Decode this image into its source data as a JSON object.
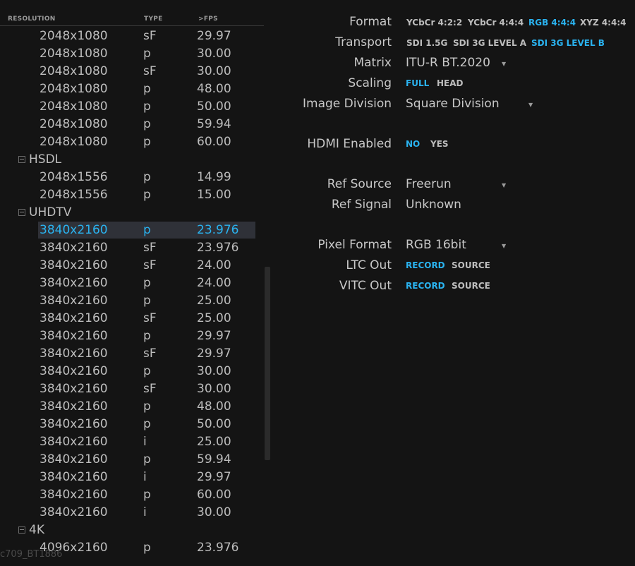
{
  "columns": {
    "resolution": "RESOLUTION",
    "type": "TYPE",
    "fps": ">FPS"
  },
  "list": [
    {
      "kind": "row",
      "res": "2048x1080",
      "type": "sF",
      "fps": "29.97"
    },
    {
      "kind": "row",
      "res": "2048x1080",
      "type": "p",
      "fps": "30.00"
    },
    {
      "kind": "row",
      "res": "2048x1080",
      "type": "sF",
      "fps": "30.00"
    },
    {
      "kind": "row",
      "res": "2048x1080",
      "type": "p",
      "fps": "48.00"
    },
    {
      "kind": "row",
      "res": "2048x1080",
      "type": "p",
      "fps": "50.00"
    },
    {
      "kind": "row",
      "res": "2048x1080",
      "type": "p",
      "fps": "59.94"
    },
    {
      "kind": "row",
      "res": "2048x1080",
      "type": "p",
      "fps": "60.00"
    },
    {
      "kind": "group",
      "label": "HSDL"
    },
    {
      "kind": "row",
      "res": "2048x1556",
      "type": "p",
      "fps": "14.99"
    },
    {
      "kind": "row",
      "res": "2048x1556",
      "type": "p",
      "fps": "15.00"
    },
    {
      "kind": "group",
      "label": "UHDTV"
    },
    {
      "kind": "row",
      "res": "3840x2160",
      "type": "p",
      "fps": "23.976",
      "selected": true
    },
    {
      "kind": "row",
      "res": "3840x2160",
      "type": "sF",
      "fps": "23.976"
    },
    {
      "kind": "row",
      "res": "3840x2160",
      "type": "sF",
      "fps": "24.00"
    },
    {
      "kind": "row",
      "res": "3840x2160",
      "type": "p",
      "fps": "24.00"
    },
    {
      "kind": "row",
      "res": "3840x2160",
      "type": "p",
      "fps": "25.00"
    },
    {
      "kind": "row",
      "res": "3840x2160",
      "type": "sF",
      "fps": "25.00"
    },
    {
      "kind": "row",
      "res": "3840x2160",
      "type": "p",
      "fps": "29.97"
    },
    {
      "kind": "row",
      "res": "3840x2160",
      "type": "sF",
      "fps": "29.97"
    },
    {
      "kind": "row",
      "res": "3840x2160",
      "type": "p",
      "fps": "30.00"
    },
    {
      "kind": "row",
      "res": "3840x2160",
      "type": "sF",
      "fps": "30.00"
    },
    {
      "kind": "row",
      "res": "3840x2160",
      "type": "p",
      "fps": "48.00"
    },
    {
      "kind": "row",
      "res": "3840x2160",
      "type": "p",
      "fps": "50.00"
    },
    {
      "kind": "row",
      "res": "3840x2160",
      "type": "i",
      "fps": "25.00"
    },
    {
      "kind": "row",
      "res": "3840x2160",
      "type": "p",
      "fps": "59.94"
    },
    {
      "kind": "row",
      "res": "3840x2160",
      "type": "i",
      "fps": "29.97"
    },
    {
      "kind": "row",
      "res": "3840x2160",
      "type": "p",
      "fps": "60.00"
    },
    {
      "kind": "row",
      "res": "3840x2160",
      "type": "i",
      "fps": "30.00"
    },
    {
      "kind": "group",
      "label": "4K"
    },
    {
      "kind": "row",
      "res": "4096x2160",
      "type": "p",
      "fps": "23.976"
    }
  ],
  "footer_label": "c709_BT1886",
  "settings": {
    "format": {
      "label": "Format",
      "options": [
        "YCbCr 4:2:2",
        "YCbCr 4:4:4",
        "RGB 4:4:4",
        "XYZ 4:4:4"
      ],
      "active": "RGB 4:4:4"
    },
    "transport": {
      "label": "Transport",
      "options": [
        "SDI 1.5G",
        "SDI 3G LEVEL A",
        "SDI 3G LEVEL B"
      ],
      "active": "SDI 3G LEVEL B"
    },
    "matrix": {
      "label": "Matrix",
      "value": "ITU-R BT.2020"
    },
    "scaling": {
      "label": "Scaling",
      "options": [
        "FULL",
        "HEAD"
      ],
      "active": "FULL"
    },
    "image_division": {
      "label": "Image Division",
      "value": "Square Division"
    },
    "hdmi": {
      "label": "HDMI Enabled",
      "options": [
        "NO",
        "YES"
      ],
      "active": "NO"
    },
    "ref_source": {
      "label": "Ref Source",
      "value": "Freerun"
    },
    "ref_signal": {
      "label": "Ref Signal",
      "value": "Unknown"
    },
    "pixel_format": {
      "label": "Pixel Format",
      "value": "RGB 16bit"
    },
    "ltc_out": {
      "label": "LTC Out",
      "options": [
        "RECORD",
        "SOURCE"
      ],
      "active": "RECORD"
    },
    "vitc_out": {
      "label": "VITC Out",
      "options": [
        "RECORD",
        "SOURCE"
      ],
      "active": "RECORD"
    }
  },
  "icons": {
    "dropdown": "chevron-down-icon",
    "group_toggle": "collapse-icon"
  },
  "colors": {
    "accent": "#2ab3f0",
    "background": "#141414",
    "selection": "#2f3138"
  }
}
